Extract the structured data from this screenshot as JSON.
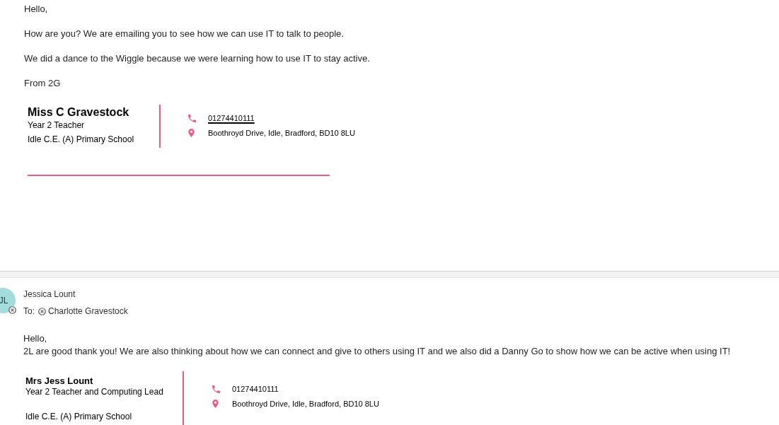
{
  "first_message": {
    "paragraphs": [
      "Hello,",
      "How are you? We are emailing you to see how we can use IT to talk to people.",
      "We did a dance to the Wiggle because we were learning how to use IT to stay active.",
      "From 2G"
    ],
    "signature": {
      "name": "Miss C Gravestock",
      "role": "Year 2 Teacher",
      "school": "Idle C.E. (A) Primary School",
      "contacts": [
        {
          "kind": "phone",
          "text": "01274410111",
          "link": true
        },
        {
          "kind": "address",
          "text": "Boothroyd Drive, Idle, Bradford, BD10 8LU",
          "link": false
        }
      ]
    }
  },
  "reply": {
    "avatar_initials": "JL",
    "sender": "Jessica Lount",
    "to_label": "To:",
    "recipients": [
      "Charlotte Gravestock"
    ],
    "lines": [
      "Hello,",
      "2L are good thank you! We are also thinking about how we can connect and give to others using IT and we also did a Danny Go to show how we can be active when using IT!"
    ],
    "signature": {
      "name": "Mrs Jess Lount",
      "role": "Year 2 Teacher and Computing Lead",
      "school": "Idle C.E. (A) Primary School",
      "contacts": [
        {
          "kind": "phone",
          "text": "01274410111",
          "link": false
        },
        {
          "kind": "address",
          "text": "Boothroyd Drive, Idle, Bradford, BD10 8LU",
          "link": false
        }
      ]
    }
  }
}
